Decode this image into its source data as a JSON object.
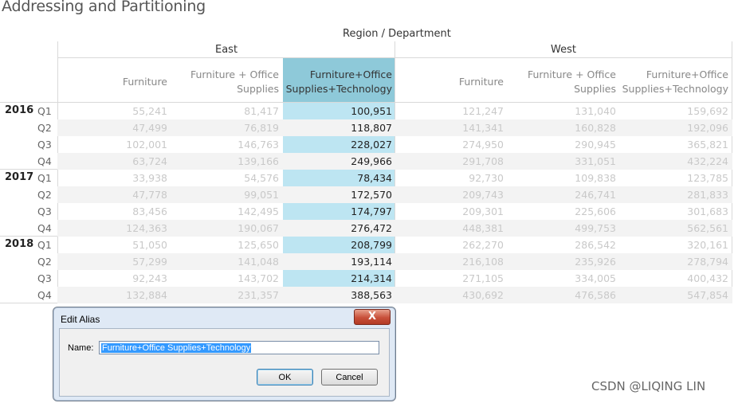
{
  "title": "Addressing and Partitioning",
  "column_title": "Region / Department",
  "regions": [
    "East",
    "West"
  ],
  "departments": [
    "Furniture",
    "Furniture + Office\nSupplies",
    "Furniture+Office\nSupplies+Technology"
  ],
  "years": [
    {
      "year": "2016",
      "quarters": [
        {
          "q": "Q1",
          "east": [
            "55,241",
            "81,417",
            "100,951"
          ],
          "west": [
            "121,247",
            "131,040",
            "159,692"
          ]
        },
        {
          "q": "Q2",
          "east": [
            "47,499",
            "76,819",
            "118,807"
          ],
          "west": [
            "141,341",
            "160,828",
            "192,096"
          ]
        },
        {
          "q": "Q3",
          "east": [
            "102,001",
            "146,763",
            "228,027"
          ],
          "west": [
            "274,950",
            "290,945",
            "365,821"
          ]
        },
        {
          "q": "Q4",
          "east": [
            "63,724",
            "139,166",
            "249,966"
          ],
          "west": [
            "291,708",
            "331,051",
            "432,224"
          ]
        }
      ]
    },
    {
      "year": "2017",
      "quarters": [
        {
          "q": "Q1",
          "east": [
            "33,938",
            "54,576",
            "78,434"
          ],
          "west": [
            "92,730",
            "109,838",
            "123,785"
          ]
        },
        {
          "q": "Q2",
          "east": [
            "47,778",
            "99,051",
            "172,570"
          ],
          "west": [
            "209,743",
            "246,741",
            "281,833"
          ]
        },
        {
          "q": "Q3",
          "east": [
            "83,456",
            "142,495",
            "174,797"
          ],
          "west": [
            "209,301",
            "225,606",
            "301,683"
          ]
        },
        {
          "q": "Q4",
          "east": [
            "124,363",
            "190,067",
            "276,472"
          ],
          "west": [
            "448,381",
            "499,753",
            "562,561"
          ]
        }
      ]
    },
    {
      "year": "2018",
      "quarters": [
        {
          "q": "Q1",
          "east": [
            "51,050",
            "125,650",
            "208,799"
          ],
          "west": [
            "262,270",
            "286,542",
            "320,161"
          ]
        },
        {
          "q": "Q2",
          "east": [
            "57,299",
            "141,048",
            "193,114"
          ],
          "west": [
            "216,108",
            "235,926",
            "278,794"
          ]
        },
        {
          "q": "Q3",
          "east": [
            "92,243",
            "143,702",
            "214,314"
          ],
          "west": [
            "271,105",
            "334,005",
            "400,432"
          ]
        },
        {
          "q": "Q4",
          "east": [
            "132,884",
            "231,357",
            "388,563"
          ],
          "west": [
            "430,692",
            "476,586",
            "547,854"
          ]
        }
      ]
    }
  ],
  "dialog": {
    "title": "Edit Alias",
    "close_label": "X",
    "name_label": "Name:",
    "name_value": "Furniture+Office Supplies+Technology",
    "ok_label": "OK",
    "cancel_label": "Cancel"
  },
  "watermark": "CSDN @LIQING LIN",
  "colors": {
    "highlight_header": "#8ec9d9",
    "highlight_column": "#bde5f2",
    "dimmed_text": "#c9c9c9"
  }
}
